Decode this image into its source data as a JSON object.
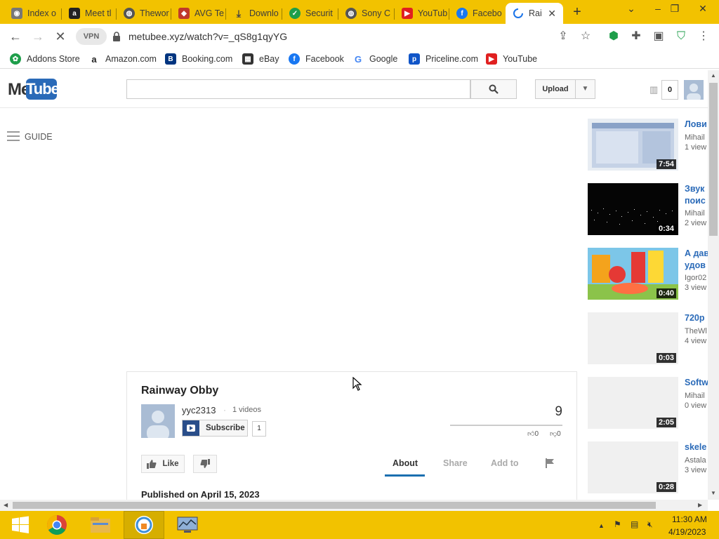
{
  "browser": {
    "tabs": [
      {
        "title": "Index o",
        "icon": "cat-icon",
        "color": "#555555"
      },
      {
        "title": "Meet tl",
        "icon": "amazon-icon",
        "color": "#222222"
      },
      {
        "title": "Thewor",
        "icon": "globe-icon",
        "color": "#555555"
      },
      {
        "title": "AVG Te",
        "icon": "avg-icon",
        "color": "#c0392b"
      },
      {
        "title": "Downlo",
        "icon": "download-icon",
        "color": "#444444"
      },
      {
        "title": "Securit",
        "icon": "shield-icon",
        "color": "#1e9e4a"
      },
      {
        "title": "Sony C",
        "icon": "globe-icon",
        "color": "#555555"
      },
      {
        "title": "YouTub",
        "icon": "youtube-icon",
        "color": "#e02020"
      },
      {
        "title": "Facebo",
        "icon": "facebook-icon",
        "color": "#1877f2"
      },
      {
        "title": "Rai",
        "icon": "loading-icon",
        "color": "#1a73e8"
      }
    ],
    "url": "metubee.xyz/watch?v=_qS8g1qyYG",
    "vpn_label": "VPN",
    "bookmarks": [
      {
        "label": "Addons Store",
        "icon": "addons-icon",
        "color": "#1e9e4a"
      },
      {
        "label": "Amazon.com",
        "icon": "amazon-icon",
        "color": "#222222"
      },
      {
        "label": "Booking.com",
        "icon": "booking-icon",
        "color": "#003580"
      },
      {
        "label": "eBay",
        "icon": "ebay-icon",
        "color": "#333333"
      },
      {
        "label": "Facebook",
        "icon": "facebook-icon",
        "color": "#1877f2"
      },
      {
        "label": "Google",
        "icon": "google-icon",
        "color": "#4285f4"
      },
      {
        "label": "Priceline.com",
        "icon": "priceline-icon",
        "color": "#1055c8"
      },
      {
        "label": "YouTube",
        "icon": "youtube-icon",
        "color": "#e02020"
      }
    ]
  },
  "site": {
    "logo_me": "Me",
    "logo_tube": "Tube",
    "search_placeholder": "",
    "upload_label": "Upload",
    "notification_count": "0",
    "guide_label": "GUIDE"
  },
  "video": {
    "title": "Rainway Obby",
    "channel": "yyc2313",
    "dot": "·",
    "channel_videos": "1 videos",
    "subscribe_label": "Subscribe",
    "subscriber_count": "1",
    "view_count": "9",
    "likes": "0",
    "dislikes": "0",
    "like_label": "Like",
    "tabs": {
      "about": "About",
      "share": "Share",
      "add_to": "Add to"
    },
    "published": "Published on April 15, 2023"
  },
  "related": [
    {
      "title": "Лови",
      "title2": "",
      "author": "Mihail",
      "views": "1 view",
      "duration": "7:54",
      "thumb": "screen"
    },
    {
      "title": "Звук",
      "title2": "поис",
      "author": "Mihail",
      "views": "2 view",
      "duration": "0:34",
      "thumb": "dark"
    },
    {
      "title": "А дав",
      "title2": "удов",
      "author": "Igor02",
      "views": "3 view",
      "duration": "0:40",
      "thumb": "cartoon"
    },
    {
      "title": "720p",
      "title2": "",
      "author": "TheWl",
      "views": "4 view",
      "duration": "0:03",
      "thumb": "blank"
    },
    {
      "title": "Softw",
      "title2": "",
      "author": "Mihail",
      "views": "0 view",
      "duration": "2:05",
      "thumb": "blank"
    },
    {
      "title": "skele",
      "title2": "",
      "author": "Astala",
      "views": "3 view",
      "duration": "0:28",
      "thumb": "blank"
    }
  ],
  "taskbar": {
    "time": "11:30 AM",
    "date": "4/19/2023"
  },
  "colors": {
    "chrome_yellow": "#f2c200",
    "link_blue": "#2a6ab8",
    "tab_underline": "#1b6fb0"
  }
}
